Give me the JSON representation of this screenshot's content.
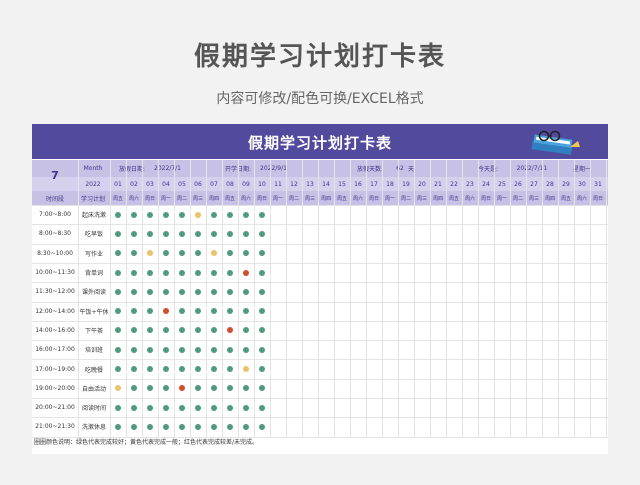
{
  "page": {
    "title": "假期学习计划打卡表",
    "subtitle": "内容可修改/配色可换/EXCEL格式"
  },
  "sheet": {
    "banner_title": "假期学习计划打卡表",
    "month_number": "7",
    "month_label": "Month",
    "year": "2022",
    "start_label": "放假日期:",
    "start_value": "2022/7/1",
    "school_label": "开学日期:",
    "school_value": "2022/9/1",
    "days_label": "放假天数:",
    "days_value": "62",
    "days_unit": "天",
    "today_label": "今天是:",
    "today_value": "2022/7/11",
    "weekday_label": "星期一",
    "time_header": "时间段",
    "plan_header": "学习计划",
    "days": [
      "01",
      "02",
      "03",
      "04",
      "05",
      "06",
      "07",
      "08",
      "09",
      "10",
      "11",
      "12",
      "13",
      "14",
      "15",
      "16",
      "17",
      "18",
      "19",
      "20",
      "21",
      "22",
      "23",
      "24",
      "25",
      "26",
      "27",
      "28",
      "29",
      "30",
      "31"
    ],
    "weekdays": [
      "周五",
      "周六",
      "周日",
      "周一",
      "周二",
      "周三",
      "周四",
      "周五",
      "周六",
      "周日",
      "周一",
      "周二",
      "周三",
      "周四",
      "周五",
      "周六",
      "周日",
      "周一",
      "周二",
      "周三",
      "周四",
      "周五",
      "周六",
      "周日",
      "周一",
      "周二",
      "周三",
      "周四",
      "周五",
      "周六",
      "周日"
    ],
    "rows": [
      {
        "time": "7:00~8:00",
        "plan": "起床洗漱",
        "marks": "GGGGGYGGGG"
      },
      {
        "time": "8:00~8:30",
        "plan": "吃早饭",
        "marks": "GGGGGGGGGG"
      },
      {
        "time": "8:30~10:00",
        "plan": "写作业",
        "marks": "GGYGGGYGGG"
      },
      {
        "time": "10:00~11:30",
        "plan": "背单词",
        "marks": "GGGGGGGGRG"
      },
      {
        "time": "11:30~12:00",
        "plan": "课外阅读",
        "marks": "GGGGGGGGGG"
      },
      {
        "time": "12:00~14:00",
        "plan": "午饭+午休",
        "marks": "GGGRGGGGGG"
      },
      {
        "time": "14:00~16:00",
        "plan": "下午茶",
        "marks": "GGGGGGGRGG"
      },
      {
        "time": "16:00~17:00",
        "plan": "培训班",
        "marks": "GGGGGGGGGG"
      },
      {
        "time": "17:00~19:00",
        "plan": "吃晚餐",
        "marks": "GGGGGGGGYG"
      },
      {
        "time": "19:00~20:00",
        "plan": "自由活动",
        "marks": "YGGGRGGGGG"
      },
      {
        "time": "20:00~21:00",
        "plan": "阅读时间",
        "marks": "GGGGGGGGGG"
      },
      {
        "time": "21:00~21:30",
        "plan": "洗漱休息",
        "marks": "GGGGGGGGGG"
      }
    ],
    "note": "圈圈颜色说明：绿色代表完成较好；黄色代表完成一般；红色代表完成较差/未完成。",
    "colors": {
      "banner": "#524a9c",
      "header": "#c7c1e6",
      "green": "#4e9c7d",
      "yellow": "#e9c46a",
      "red": "#d24d2e"
    },
    "icon": "books-glasses-icon"
  }
}
